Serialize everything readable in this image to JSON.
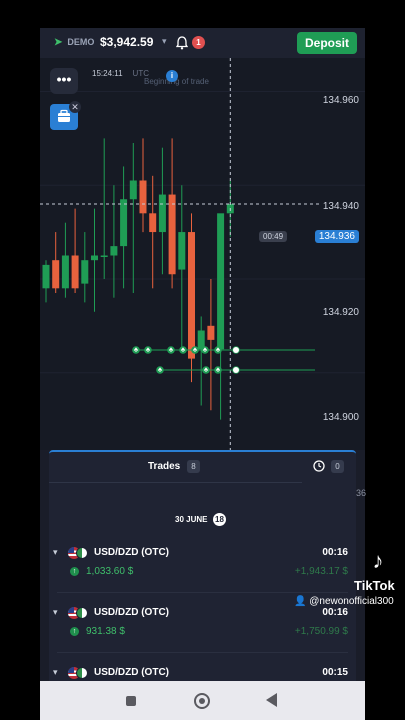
{
  "header": {
    "account_mode": "DEMO",
    "balance": "$3,942.59",
    "notifications": "1",
    "deposit_label": "Deposit"
  },
  "chart": {
    "time_label": "15:24:11",
    "tz_label": "UTC",
    "info_text": "Beginning of trade",
    "timer": "00:49",
    "current_price": "134.936",
    "price_ticks": [
      "134.960",
      "134.940",
      "134.920",
      "134.900"
    ],
    "menu_glyph": "•••",
    "colors": {
      "up": "#1f9d55",
      "down": "#e8623e",
      "accent": "#2a7fd4"
    }
  },
  "chart_data": {
    "type": "candlestick",
    "ylim": [
      134.885,
      134.965
    ],
    "candles": [
      {
        "o": 134.918,
        "h": 134.924,
        "l": 134.915,
        "c": 134.923
      },
      {
        "o": 134.924,
        "h": 134.93,
        "l": 134.917,
        "c": 134.918
      },
      {
        "o": 134.918,
        "h": 134.932,
        "l": 134.916,
        "c": 134.925
      },
      {
        "o": 134.925,
        "h": 134.935,
        "l": 134.917,
        "c": 134.918
      },
      {
        "o": 134.919,
        "h": 134.93,
        "l": 134.915,
        "c": 134.924
      },
      {
        "o": 134.924,
        "h": 134.935,
        "l": 134.913,
        "c": 134.925
      },
      {
        "o": 134.925,
        "h": 134.95,
        "l": 134.92,
        "c": 134.925
      },
      {
        "o": 134.925,
        "h": 134.94,
        "l": 134.916,
        "c": 134.927
      },
      {
        "o": 134.927,
        "h": 134.944,
        "l": 134.918,
        "c": 134.937
      },
      {
        "o": 134.937,
        "h": 134.949,
        "l": 134.917,
        "c": 134.941
      },
      {
        "o": 134.941,
        "h": 134.95,
        "l": 134.93,
        "c": 134.934
      },
      {
        "o": 134.934,
        "h": 134.942,
        "l": 134.918,
        "c": 134.93
      },
      {
        "o": 134.93,
        "h": 134.948,
        "l": 134.921,
        "c": 134.938
      },
      {
        "o": 134.938,
        "h": 134.95,
        "l": 134.918,
        "c": 134.921
      },
      {
        "o": 134.922,
        "h": 134.94,
        "l": 134.905,
        "c": 134.93
      },
      {
        "o": 134.93,
        "h": 134.934,
        "l": 134.898,
        "c": 134.903
      },
      {
        "o": 134.905,
        "h": 134.912,
        "l": 134.893,
        "c": 134.909
      },
      {
        "o": 134.91,
        "h": 134.92,
        "l": 134.892,
        "c": 134.907
      },
      {
        "o": 134.905,
        "h": 134.925,
        "l": 134.89,
        "c": 134.934
      },
      {
        "o": 134.934,
        "h": 134.941,
        "l": 134.929,
        "c": 134.936
      }
    ]
  },
  "trades_panel": {
    "tab_label": "Trades",
    "tab_count": "8",
    "pending_count": "0",
    "date_label": "30 JUNE",
    "date_count": "18",
    "items": [
      {
        "pair": "USD/DZD (OTC)",
        "duration": "00:16",
        "amount": "1,033.60 $",
        "profit": "+1,943.17 $"
      },
      {
        "pair": "USD/DZD (OTC)",
        "duration": "00:16",
        "amount": "931.38 $",
        "profit": "+1,750.99 $"
      },
      {
        "pair": "USD/DZD (OTC)",
        "duration": "00:15",
        "amount": "",
        "profit": ""
      }
    ]
  },
  "overlay": {
    "brand": "TikTok",
    "handle": "@newonofficial300",
    "edge_text": "36"
  }
}
